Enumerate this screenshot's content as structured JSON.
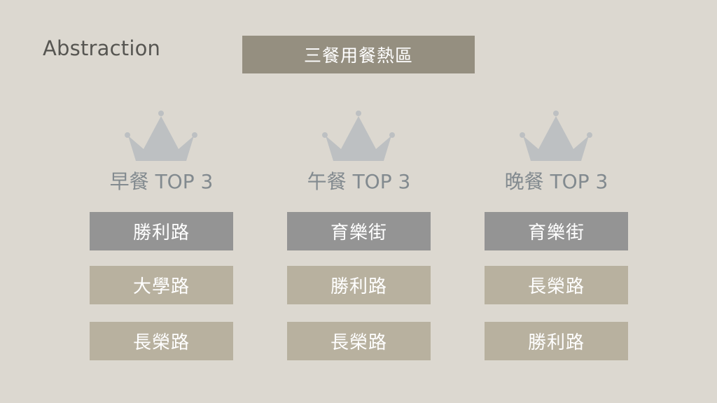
{
  "header": {
    "abstraction": "Abstraction",
    "title": "三餐用餐熱區"
  },
  "meals": [
    {
      "title": "早餐 TOP 3",
      "ranks": [
        "勝利路",
        "大學路",
        "長榮路"
      ]
    },
    {
      "title": "午餐 TOP 3",
      "ranks": [
        "育樂街",
        "勝利路",
        "長榮路"
      ]
    },
    {
      "title": "晚餐 TOP 3",
      "ranks": [
        "育樂街",
        "長榮路",
        "勝利路"
      ]
    }
  ],
  "colors": {
    "background": "#dcd8d0",
    "title_box": "#958f80",
    "top_rank": "#949494",
    "other_rank": "#b8b19f",
    "crown": "#bdc0c2",
    "meal_title": "#828a8f"
  },
  "icons": {
    "crown": "crown-icon"
  }
}
